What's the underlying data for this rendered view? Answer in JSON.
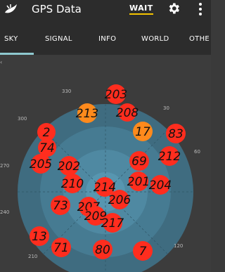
{
  "app": {
    "title": "GPS Data",
    "wait_label": "WAIT"
  },
  "icons": {
    "app": "moon-satellite-icon",
    "settings": "gear-icon",
    "overflow": "more-vert-icon"
  },
  "tabs": [
    {
      "label": "SKY",
      "selected": true
    },
    {
      "label": "SIGNAL"
    },
    {
      "label": "INFO"
    },
    {
      "label": "WORLD"
    },
    {
      "label": "OTHE"
    }
  ],
  "colors": {
    "accent_wait": "#f5c400",
    "tab_indicator": "#8ec9cf",
    "sat_red": "#ff2d1e",
    "sat_orange": "#ff8a1c"
  },
  "degree_labels": [
    "330",
    "30",
    "300",
    "60",
    "270",
    "240",
    "210",
    "120"
  ],
  "satellites": [
    {
      "prn": "203",
      "color": "red"
    },
    {
      "prn": "213",
      "color": "orange"
    },
    {
      "prn": "208",
      "color": "red"
    },
    {
      "prn": "2",
      "color": "red"
    },
    {
      "prn": "17",
      "color": "orange"
    },
    {
      "prn": "83",
      "color": "red"
    },
    {
      "prn": "74",
      "color": "red"
    },
    {
      "prn": "212",
      "color": "red"
    },
    {
      "prn": "205",
      "color": "red"
    },
    {
      "prn": "202",
      "color": "red"
    },
    {
      "prn": "69",
      "color": "red"
    },
    {
      "prn": "210",
      "color": "red"
    },
    {
      "prn": "201",
      "color": "red"
    },
    {
      "prn": "204",
      "color": "red"
    },
    {
      "prn": "214",
      "color": "red"
    },
    {
      "prn": "206",
      "color": "red"
    },
    {
      "prn": "73",
      "color": "red"
    },
    {
      "prn": "207",
      "color": "red"
    },
    {
      "prn": "209",
      "color": "red"
    },
    {
      "prn": "217",
      "color": "red"
    },
    {
      "prn": "13",
      "color": "red"
    },
    {
      "prn": "71",
      "color": "red"
    },
    {
      "prn": "80",
      "color": "red"
    },
    {
      "prn": "7",
      "color": "red"
    }
  ]
}
